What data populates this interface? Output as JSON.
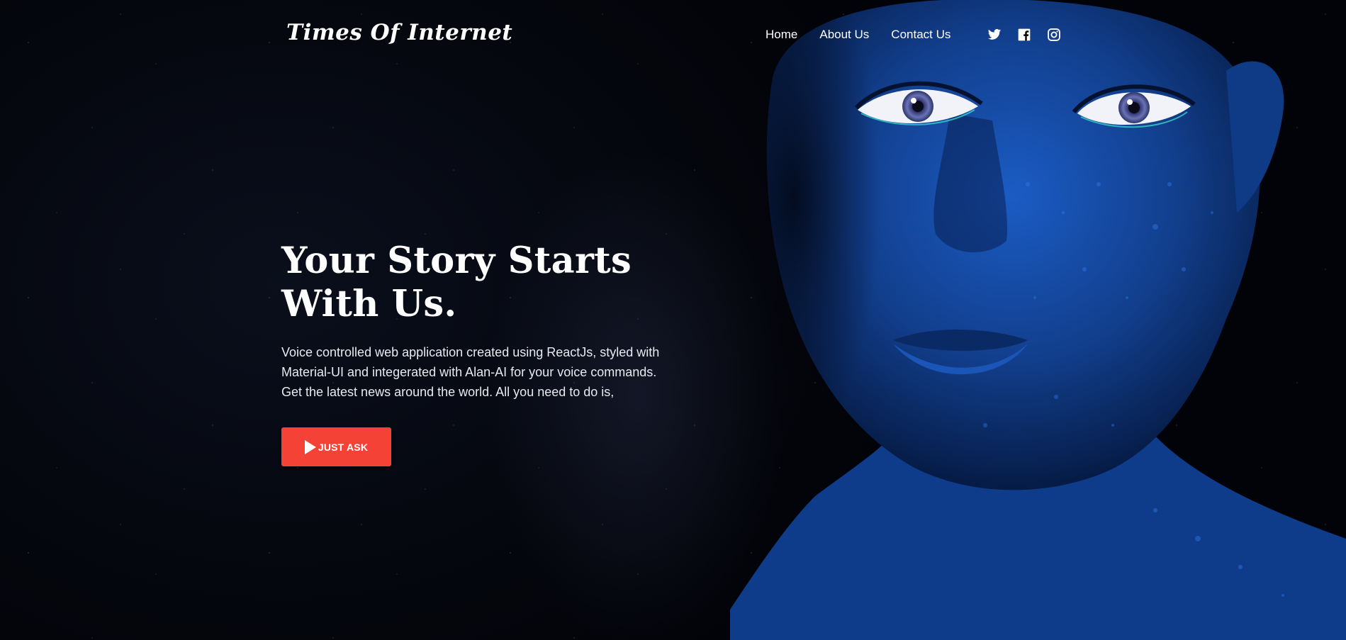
{
  "header": {
    "logo": "Times Of Internet",
    "nav": [
      {
        "label": "Home"
      },
      {
        "label": "About Us"
      },
      {
        "label": "Contact Us"
      }
    ],
    "social_icons": [
      "twitter-icon",
      "facebook-icon",
      "instagram-icon"
    ]
  },
  "hero": {
    "title_line1": "Your Story Starts",
    "title_line2": "With Us.",
    "description_line1": "Voice controlled web application created using ReactJs, styled with",
    "description_line2": "Material-UI and integerated with Alan-AI for your voice commands.",
    "description_line3": "Get the latest news around the world. All you need to do is,",
    "cta_label": "JUST ASK",
    "cta_icon": "play-icon"
  },
  "colors": {
    "background": "#04060d",
    "accent": "#f44336",
    "portrait_blue": "#1a4fa8",
    "text": "#ffffff"
  }
}
